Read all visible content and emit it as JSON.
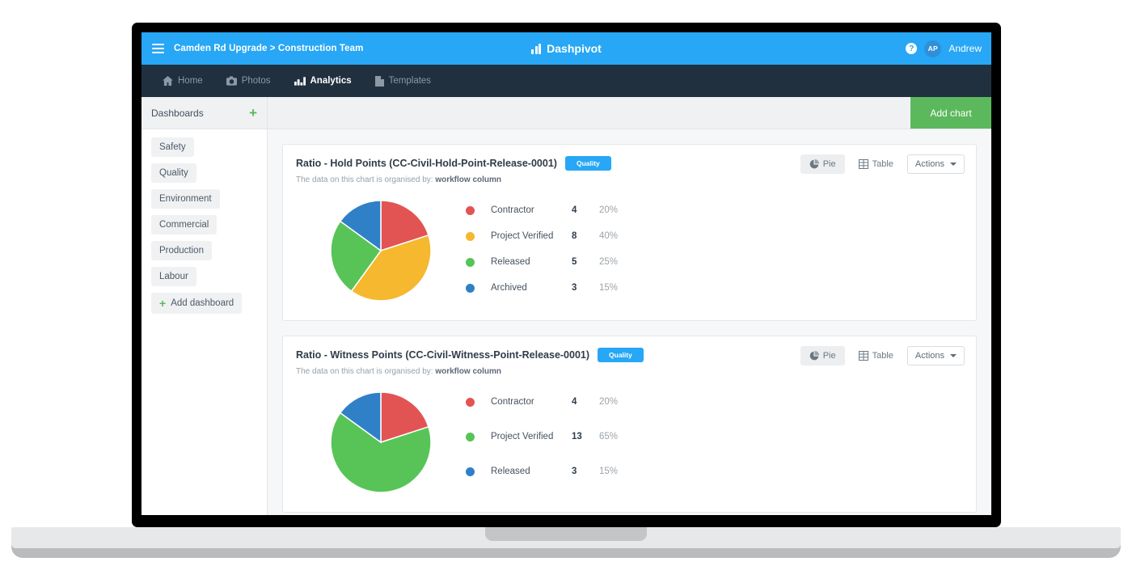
{
  "topbar": {
    "menu_icon": "hamburger-icon",
    "breadcrumb": "Camden Rd Upgrade > Construction Team",
    "brand_name": "Dashpivot",
    "brand_logo_icon": "bar-chart-logo-icon",
    "help_icon": "question-mark-icon",
    "help_label": "?",
    "avatar_initials": "AP",
    "user_name": "Andrew",
    "bg_color": "#27a7f5"
  },
  "mainnav": {
    "bg_color": "#20303f",
    "items": [
      {
        "label": "Home",
        "icon": "home-icon",
        "active": false
      },
      {
        "label": "Photos",
        "icon": "camera-icon",
        "active": false
      },
      {
        "label": "Analytics",
        "icon": "analytics-chart-icon",
        "active": true
      },
      {
        "label": "Templates",
        "icon": "document-icon",
        "active": false
      }
    ]
  },
  "sidebar": {
    "title": "Dashboards",
    "add_icon": "plus-icon",
    "items": [
      {
        "label": "Safety"
      },
      {
        "label": "Quality"
      },
      {
        "label": "Environment"
      },
      {
        "label": "Commercial"
      },
      {
        "label": "Production"
      },
      {
        "label": "Labour"
      }
    ],
    "add_dashboard_label": "Add dashboard"
  },
  "toolbar": {
    "add_chart_label": "Add chart",
    "add_chart_color": "#5cb85c"
  },
  "card_tools": {
    "pie_label": "Pie",
    "pie_icon": "pie-chart-icon",
    "table_label": "Table",
    "table_icon": "table-grid-icon",
    "actions_label": "Actions",
    "actions_caret_icon": "chevron-down-icon"
  },
  "cards": [
    {
      "title": "Ratio - Hold Points (CC-Civil-Hold-Point-Release-0001)",
      "badge": "Quality",
      "subtitle_prefix": "The data on this chart is organised by:",
      "subtitle_bold": "workflow column",
      "chart_data": {
        "type": "pie",
        "title": "Ratio - Hold Points (CC-Civil-Hold-Point-Release-0001)",
        "categories": [
          "Contractor",
          "Project Verified",
          "Released",
          "Archived"
        ],
        "values": [
          4,
          8,
          5,
          3
        ],
        "percentages": [
          "20%",
          "40%",
          "25%",
          "15%"
        ],
        "colors": [
          "#e25453",
          "#f5b82e",
          "#58c457",
          "#3080c8"
        ],
        "legend": "right",
        "start_angle": 0
      }
    },
    {
      "title": "Ratio - Witness Points (CC-Civil-Witness-Point-Release-0001)",
      "badge": "Quality",
      "subtitle_prefix": "The data on this chart is organised by:",
      "subtitle_bold": "workflow column",
      "chart_data": {
        "type": "pie",
        "title": "Ratio - Witness Points (CC-Civil-Witness-Point-Release-0001)",
        "categories": [
          "Contractor",
          "Project Verified",
          "Released"
        ],
        "values": [
          4,
          13,
          3
        ],
        "percentages": [
          "20%",
          "65%",
          "15%"
        ],
        "colors": [
          "#e25453",
          "#58c457",
          "#3080c8"
        ],
        "legend": "right",
        "start_angle": 0
      }
    }
  ]
}
